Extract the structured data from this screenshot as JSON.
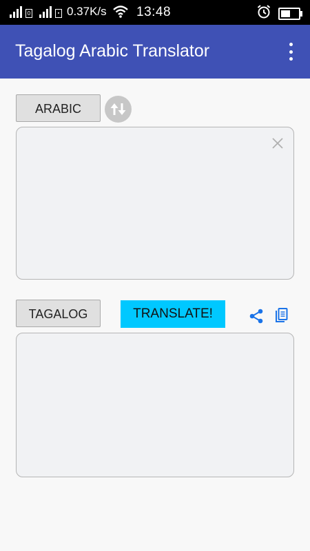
{
  "status_bar": {
    "network_speed": "0.37K/s",
    "time": "13:48",
    "sim1_label": "0",
    "battery_level": 0.55
  },
  "app_bar": {
    "title": "Tagalog Arabic Translator",
    "menu_icon": "more-vert-icon"
  },
  "source": {
    "language": "ARABIC",
    "text": "",
    "swap_icon": "swap-vertical-icon",
    "clear_icon": "close-icon"
  },
  "target": {
    "language": "TAGALOG",
    "text": "",
    "share_icon": "share-icon",
    "copy_icon": "copy-icon"
  },
  "translate_label": "TRANSLATE!",
  "colors": {
    "app_bar": "#3f51b5",
    "translate_button": "#00c8ff",
    "icon_accent": "#1a73e8"
  }
}
